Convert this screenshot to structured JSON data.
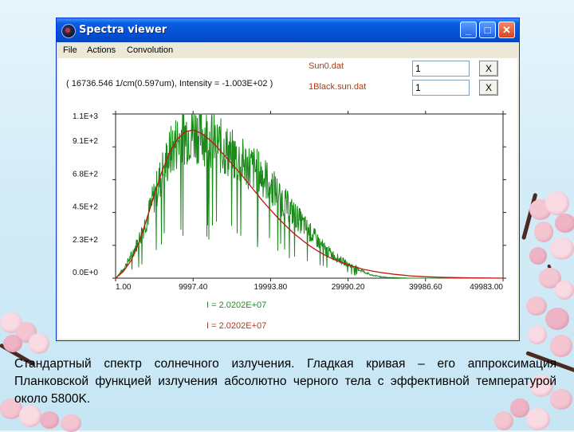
{
  "window": {
    "title": "Spectra viewer",
    "controls": {
      "minimize": "_",
      "maximize": "□",
      "close": "✕"
    }
  },
  "menu": [
    "File",
    "Actions",
    "Convolution"
  ],
  "files": [
    {
      "name": "Sun0.dat",
      "value": "1",
      "remove": "X"
    },
    {
      "name": "1Black.sun.dat",
      "value": "1",
      "remove": "X"
    }
  ],
  "cursor_readout": "( 16736.546 1/cm(0.597um), Intensity = -1.003E+02 )",
  "integrals": [
    "I = 2.0202E+07",
    "I = 2.0202E+07"
  ],
  "caption": "Стандартный спектр солнечного излучения. Гладкая кривая – его аппроксимация Планковской функцией излучения абсолютно черного тела с эффективной температурой около 5800K.",
  "colors": {
    "spectrum": "#1a8a1a",
    "blackbody": "#c01515",
    "file_label": "#b03a14"
  },
  "chart_data": {
    "type": "line",
    "x_ticks": [
      "1.00",
      "9997.40",
      "19993.80",
      "29990.20",
      "39986.60",
      "49983.00"
    ],
    "y_ticks": [
      "0.0E+0",
      "2.3E+2",
      "4.5E+2",
      "6.8E+2",
      "9.1E+2",
      "1.1E+3"
    ],
    "xlim": [
      1,
      49983
    ],
    "ylim": [
      0,
      1120
    ],
    "series": [
      {
        "name": "Sun0.dat",
        "x": [
          1,
          1000,
          2000,
          3000,
          4000,
          5000,
          6000,
          7000,
          8000,
          9000,
          10000,
          11000,
          12000,
          13000,
          14000,
          15000,
          16000,
          17000,
          18000,
          19000,
          20000,
          21000,
          22000,
          23000,
          24000,
          25000,
          26000,
          27000,
          28000,
          29000,
          30000,
          31000,
          32000,
          33000,
          35000,
          38000,
          41000,
          44000,
          47000,
          49983
        ],
        "y": [
          0,
          60,
          150,
          260,
          400,
          560,
          720,
          850,
          940,
          985,
          1000,
          990,
          960,
          920,
          880,
          840,
          800,
          770,
          740,
          700,
          640,
          570,
          500,
          440,
          380,
          320,
          260,
          200,
          160,
          125,
          95,
          70,
          45,
          20,
          5,
          0,
          0,
          0,
          0,
          0
        ]
      },
      {
        "name": "1Black.sun.dat",
        "x": [
          1,
          1000,
          2000,
          3000,
          4000,
          5000,
          6000,
          7000,
          8000,
          9000,
          10000,
          11000,
          12000,
          13000,
          14000,
          15000,
          16000,
          17000,
          18000,
          19000,
          20000,
          21000,
          22000,
          23000,
          24000,
          25000,
          26000,
          27000,
          28000,
          30000,
          32000,
          34000,
          36000,
          38000,
          40000,
          42000,
          44000,
          46000,
          48000,
          49983
        ],
        "y": [
          0,
          45,
          120,
          240,
          400,
          570,
          730,
          860,
          950,
          1000,
          1010,
          990,
          950,
          900,
          840,
          780,
          720,
          655,
          590,
          525,
          465,
          408,
          355,
          305,
          262,
          222,
          188,
          157,
          131,
          90,
          60,
          40,
          26,
          16,
          10,
          6,
          4,
          2,
          1,
          0
        ]
      }
    ]
  }
}
